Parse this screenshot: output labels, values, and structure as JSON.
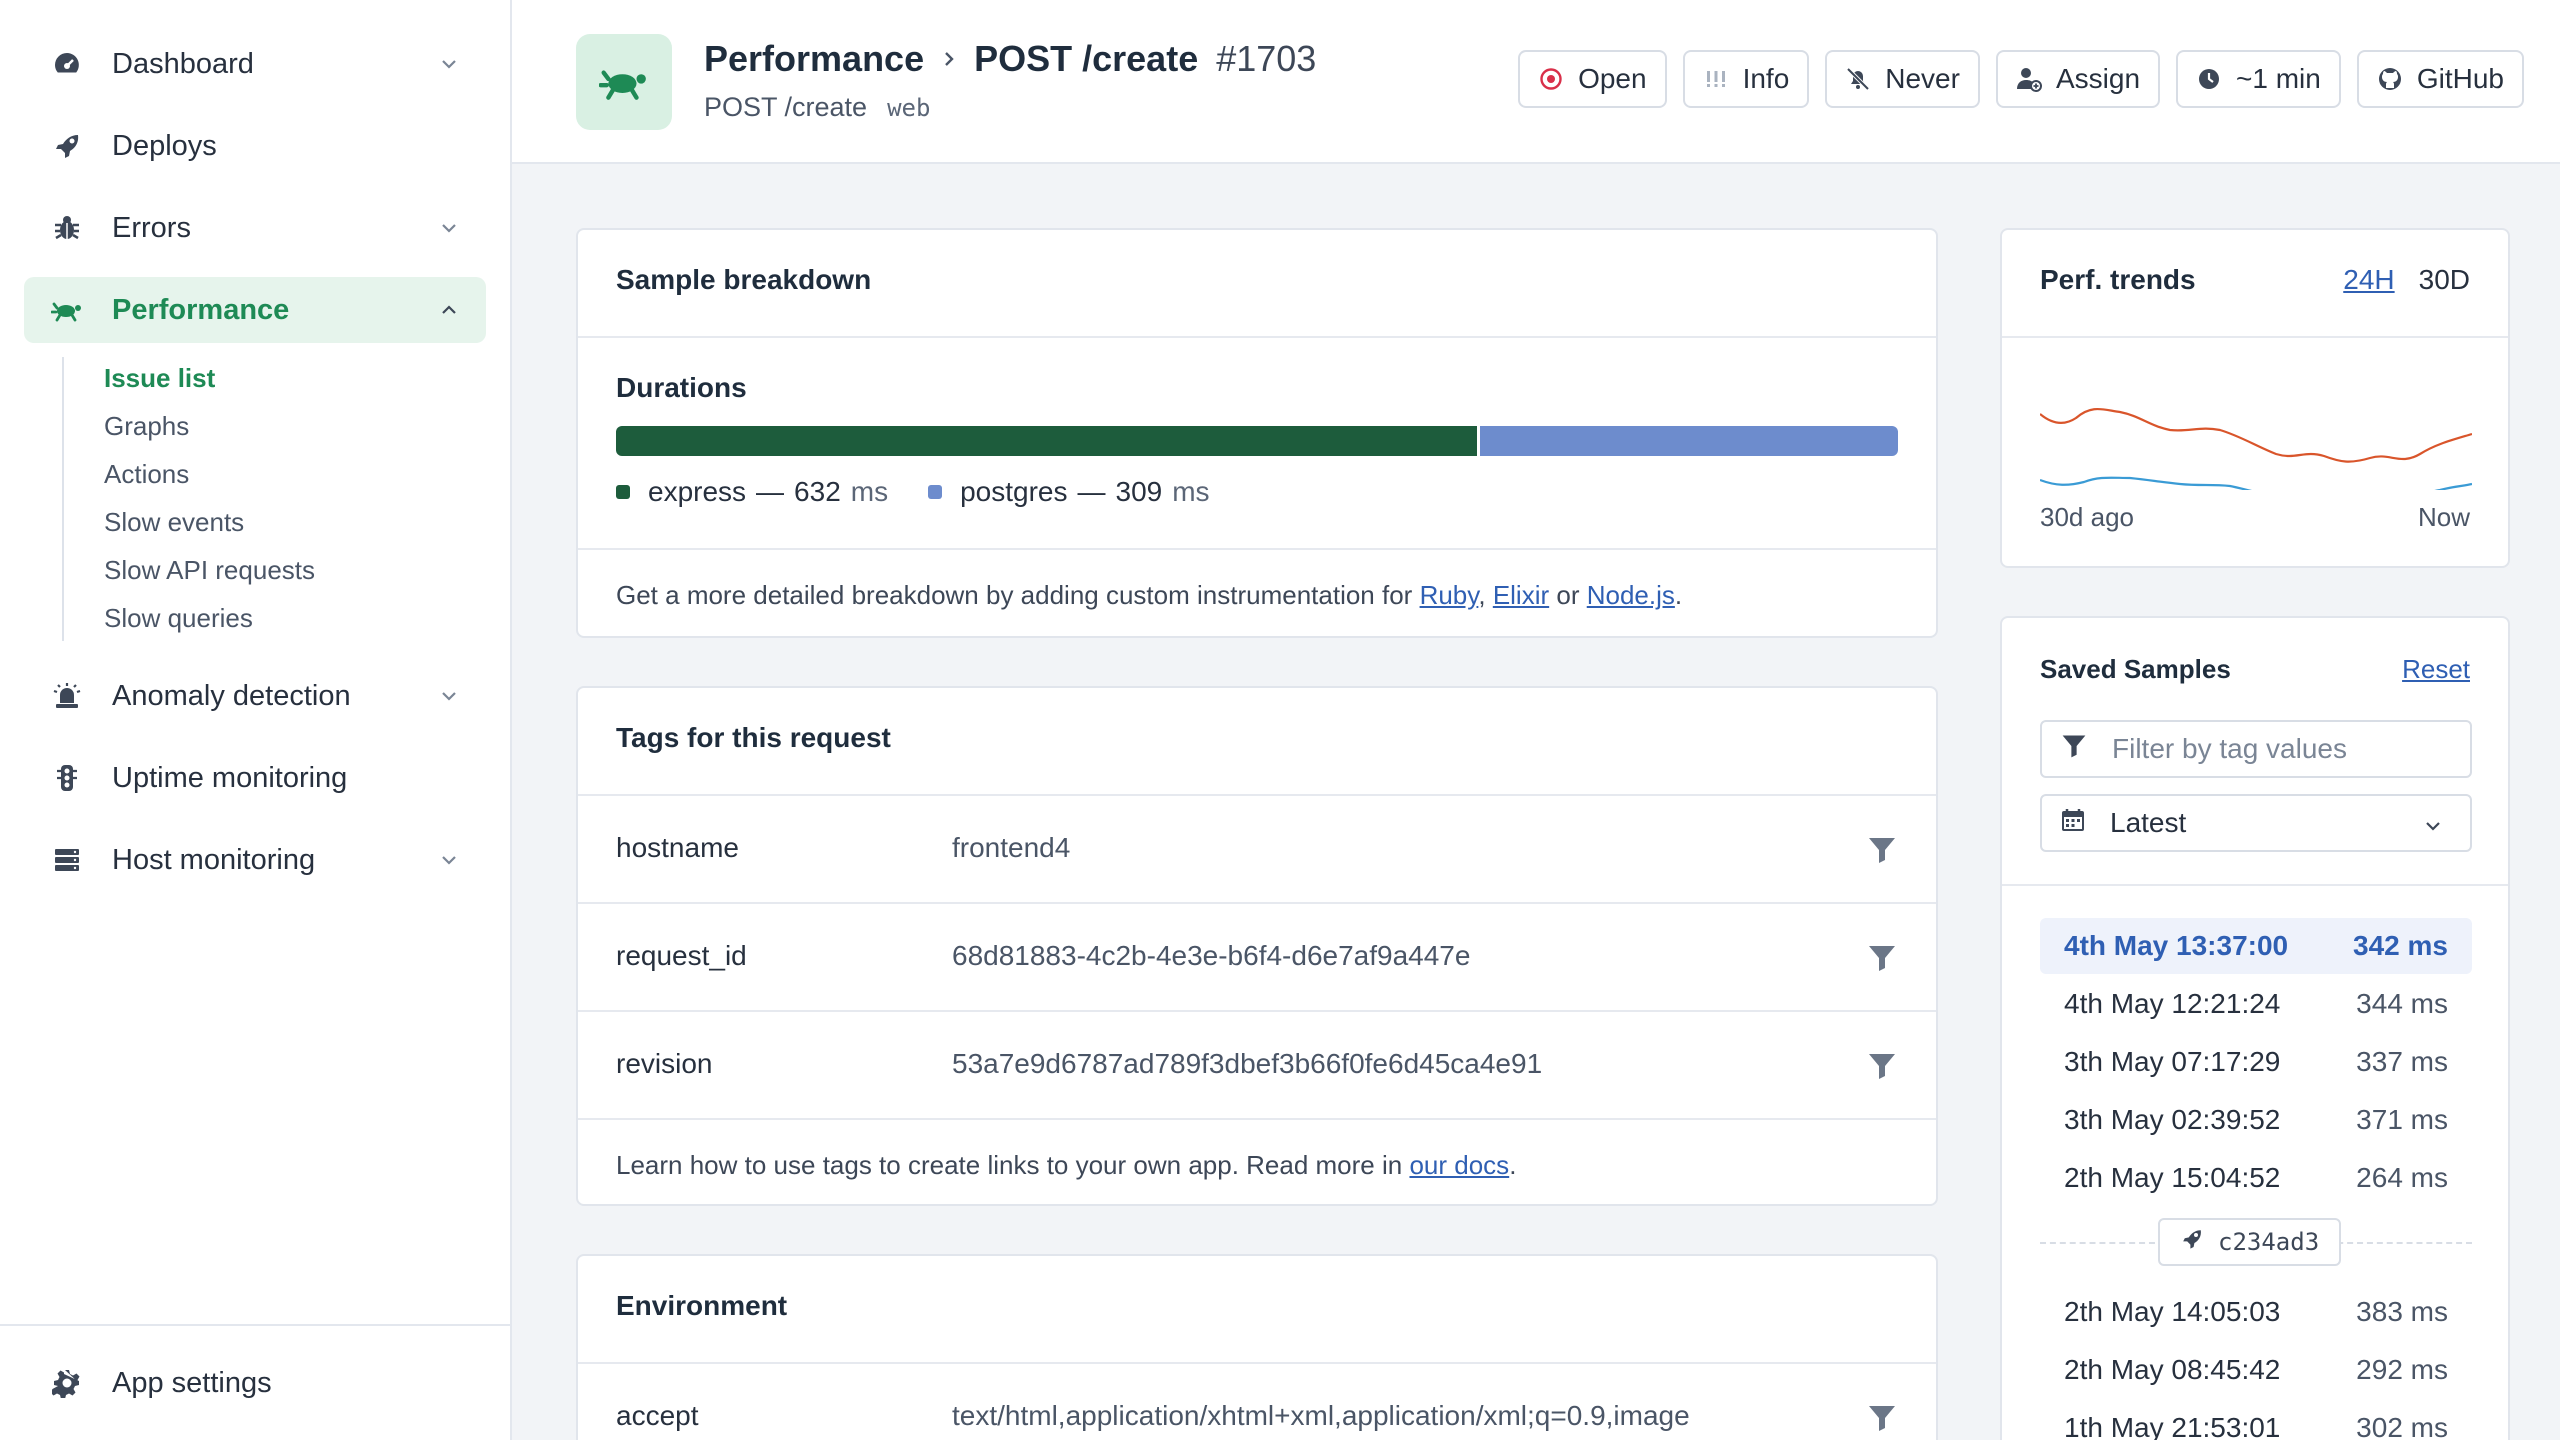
{
  "sidebar": {
    "items": [
      {
        "label": "Dashboard",
        "icon": "dashboard-gauge-icon",
        "has_chevron": true
      },
      {
        "label": "Deploys",
        "icon": "rocket-icon",
        "has_chevron": false
      },
      {
        "label": "Errors",
        "icon": "bug-icon",
        "has_chevron": true
      },
      {
        "label": "Performance",
        "icon": "turtle-icon",
        "has_chevron": true,
        "active": true
      },
      {
        "label": "Anomaly detection",
        "icon": "siren-icon",
        "has_chevron": true
      },
      {
        "label": "Uptime monitoring",
        "icon": "traffic-light-icon",
        "has_chevron": false
      },
      {
        "label": "Host monitoring",
        "icon": "server-icon",
        "has_chevron": true
      }
    ],
    "subnav": [
      "Issue list",
      "Graphs",
      "Actions",
      "Slow events",
      "Slow API requests",
      "Slow queries"
    ],
    "subnav_active": "Issue list",
    "settings_label": "App settings"
  },
  "header": {
    "crumb_parent": "Performance",
    "crumb_current": "POST /create",
    "issue_number": "#1703",
    "subtitle": "POST /create",
    "namespace": "web",
    "buttons": {
      "open": "Open",
      "info": "Info",
      "never": "Never",
      "assign": "Assign",
      "time": "~1 min",
      "github": "GitHub"
    }
  },
  "breakdown": {
    "title": "Sample breakdown",
    "durations_title": "Durations",
    "segments": [
      {
        "name": "express",
        "value": 632,
        "color": "#1d5c3c"
      },
      {
        "name": "postgres",
        "value": 309,
        "color": "#6d8ccd"
      }
    ],
    "unit": "ms",
    "separator": "—",
    "note_prefix": "Get a more detailed breakdown by adding custom instrumentation for ",
    "link_ruby": "Ruby",
    "comma": ",",
    "link_elixir": "Elixir",
    "or_text": " or ",
    "link_node": "Node.js",
    "period": "."
  },
  "tags": {
    "title": "Tags for this request",
    "rows": [
      {
        "key": "hostname",
        "value": "frontend4"
      },
      {
        "key": "request_id",
        "value": "68d81883-4c2b-4e3e-b6f4-d6e7af9a447e"
      },
      {
        "key": "revision",
        "value": "53a7e9d6787ad789f3dbef3b66f0fe6d45ca4e91"
      }
    ],
    "note_prefix": "Learn how to use tags to create links to your own app. Read more in ",
    "note_link": "our docs",
    "period": "."
  },
  "environment": {
    "title": "Environment",
    "rows": [
      {
        "key": "accept",
        "value": "text/html,application/xhtml+xml,application/xml;q=0.9,image"
      }
    ]
  },
  "trends": {
    "title": "Perf. trends",
    "tabs": [
      "24H",
      "30D"
    ],
    "active_tab": "24H",
    "start_label": "30d ago",
    "end_label": "Now",
    "colors": {
      "primary": "#d9552b",
      "secondary": "#3a9bd5"
    }
  },
  "samples": {
    "title": "Saved Samples",
    "reset": "Reset",
    "filter_placeholder": "Filter by tag values",
    "sort_value": "Latest",
    "items": [
      {
        "time": "4th May 13:37:00",
        "ms": "342 ms",
        "selected": true
      },
      {
        "time": "4th May 12:21:24",
        "ms": "344 ms"
      },
      {
        "time": "3th May 07:17:29",
        "ms": "337 ms"
      },
      {
        "time": "3th May 02:39:52",
        "ms": "371 ms"
      },
      {
        "time": "2th May 15:04:52",
        "ms": "264 ms"
      },
      {
        "time": "2th May 14:05:03",
        "ms": "383 ms"
      },
      {
        "time": "2th May 08:45:42",
        "ms": "292 ms"
      },
      {
        "time": "1th May 21:53:01",
        "ms": "302 ms"
      }
    ],
    "deploy_marker": "c234ad3"
  },
  "colors": {
    "accent_green": "#1e8a55",
    "link_blue": "#2f5fb3",
    "open_red": "#d9304a"
  }
}
